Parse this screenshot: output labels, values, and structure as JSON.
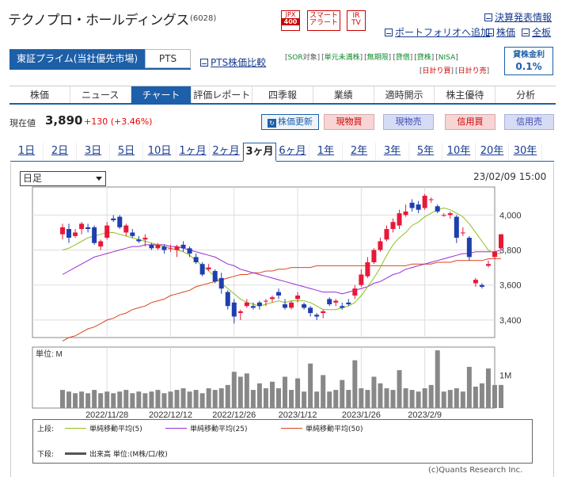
{
  "header": {
    "company": "テクノプロ・ホールディングス",
    "code": "(6028)",
    "badge_jpx_top": "JPX",
    "badge_jpx_bottom": "400",
    "badge_smart_1": "スマート",
    "badge_smart_2": "アラート",
    "badge_ir_1": "IR",
    "badge_ir_2": "TV",
    "link_results": "決算発表情報",
    "link_portfolio": "ポートフォリオへ追加",
    "link_price": "株価",
    "link_board": "全板"
  },
  "market_tabs": {
    "active": "東証プライム(当社優先市場)",
    "pts": "PTS",
    "pts_compare": "PTS株価比較"
  },
  "tags": [
    "[",
    "SOR",
    "対象",
    "]",
    "[",
    "単元未満株",
    "]",
    "[",
    "無期限",
    "]",
    "[",
    "貸借",
    "]",
    "[",
    "貸株",
    "]",
    "[",
    "NISA",
    "]",
    "[",
    "日計り買",
    "]",
    "[",
    "日計り売",
    "]"
  ],
  "lending_rate": {
    "label": "貸株金利",
    "value": "0.1%"
  },
  "nav": [
    "株価",
    "ニュース",
    "チャート",
    "評価レポート",
    "四季報",
    "業績",
    "適時開示",
    "株主優待",
    "分析"
  ],
  "nav_active_index": 2,
  "quote": {
    "label": "現在値",
    "price": "3,890",
    "change": "+130 (+3.46%)"
  },
  "buttons": {
    "update": "株価更新",
    "spot_buy": "現物買",
    "spot_sell": "現物売",
    "margin_buy": "信用買",
    "margin_sell": "信用売"
  },
  "periods": [
    "1日",
    "2日",
    "3日",
    "5日",
    "10日",
    "1ヶ月",
    "2ヶ月",
    "3ヶ月",
    "6ヶ月",
    "1年",
    "2年",
    "3年",
    "5年",
    "10年",
    "20年",
    "30年"
  ],
  "period_active_index": 7,
  "chart_controls": {
    "interval": "日足",
    "datetime": "23/02/09 15:00"
  },
  "legend": {
    "upper_label": "上段:",
    "lower_label": "下段:",
    "ma5": "単純移動平均(5)",
    "ma25": "単純移動平均(25)",
    "ma50": "単純移動平均(50)",
    "volume": "出来高 単位:(M株/口/枚)",
    "colors": {
      "ma5": "#8fbf1e",
      "ma25": "#9a2bd1",
      "ma50": "#d9461f",
      "volume": "#555555",
      "up": "#e8183a",
      "down": "#1f3fae"
    }
  },
  "copyright": "(c)Quants Research Inc.",
  "chart_data": {
    "type": "candlestick",
    "price_ticks": [
      "4,000",
      "3,800",
      "3,600",
      "3,400"
    ],
    "price_tick_values": [
      4000,
      3800,
      3600,
      3400
    ],
    "ylim": [
      3300,
      4160
    ],
    "volume_unit_label": "単位: M",
    "volume_tick": "1M",
    "volume_ylim": [
      0,
      1.85
    ],
    "date_ticks": [
      "2022/11/28",
      "2022/12/12",
      "2022/12/26",
      "2023/1/12",
      "2023/1/26",
      "2023/2/9"
    ],
    "date_tick_index": [
      7,
      17,
      27,
      37,
      47,
      57
    ],
    "candles": [
      [
        3890,
        3950,
        3860,
        3930
      ],
      [
        3920,
        3950,
        3840,
        3870
      ],
      [
        3880,
        3920,
        3870,
        3900
      ],
      [
        3920,
        3960,
        3890,
        3950
      ],
      [
        3930,
        3950,
        3900,
        3920
      ],
      [
        3930,
        3940,
        3830,
        3840
      ],
      [
        3820,
        3860,
        3800,
        3850
      ],
      [
        3870,
        3960,
        3860,
        3940
      ],
      [
        3980,
        4000,
        3960,
        3970
      ],
      [
        3990,
        4000,
        3920,
        3930
      ],
      [
        3900,
        3950,
        3880,
        3940
      ],
      [
        3900,
        3920,
        3870,
        3880
      ],
      [
        3860,
        3880,
        3840,
        3850
      ],
      [
        3860,
        3890,
        3820,
        3870
      ],
      [
        3830,
        3840,
        3800,
        3810
      ],
      [
        3810,
        3840,
        3800,
        3830
      ],
      [
        3820,
        3830,
        3780,
        3800
      ],
      [
        3810,
        3830,
        3790,
        3810
      ],
      [
        3800,
        3830,
        3760,
        3820
      ],
      [
        3830,
        3850,
        3790,
        3810
      ],
      [
        3810,
        3820,
        3760,
        3780
      ],
      [
        3760,
        3780,
        3720,
        3730
      ],
      [
        3720,
        3730,
        3650,
        3660
      ],
      [
        3690,
        3720,
        3680,
        3700
      ],
      [
        3680,
        3690,
        3610,
        3620
      ],
      [
        3640,
        3670,
        3550,
        3580
      ],
      [
        3560,
        3570,
        3460,
        3480
      ],
      [
        3500,
        3520,
        3380,
        3420
      ],
      [
        3440,
        3460,
        3400,
        3450
      ],
      [
        3480,
        3520,
        3470,
        3500
      ],
      [
        3480,
        3500,
        3460,
        3470
      ],
      [
        3500,
        3510,
        3460,
        3480
      ],
      [
        3510,
        3520,
        3480,
        3510
      ],
      [
        3520,
        3540,
        3500,
        3530
      ],
      [
        3560,
        3580,
        3520,
        3540
      ],
      [
        3490,
        3520,
        3460,
        3470
      ],
      [
        3470,
        3510,
        3460,
        3500
      ],
      [
        3520,
        3560,
        3500,
        3540
      ],
      [
        3490,
        3500,
        3460,
        3470
      ],
      [
        3470,
        3480,
        3420,
        3440
      ],
      [
        3430,
        3440,
        3400,
        3420
      ],
      [
        3440,
        3460,
        3410,
        3450
      ],
      [
        3520,
        3530,
        3480,
        3490
      ],
      [
        3500,
        3520,
        3480,
        3510
      ],
      [
        3480,
        3500,
        3460,
        3470
      ],
      [
        3500,
        3520,
        3480,
        3490
      ],
      [
        3540,
        3600,
        3520,
        3580
      ],
      [
        3600,
        3690,
        3590,
        3660
      ],
      [
        3650,
        3760,
        3640,
        3730
      ],
      [
        3730,
        3810,
        3720,
        3800
      ],
      [
        3800,
        3870,
        3790,
        3850
      ],
      [
        3860,
        3940,
        3850,
        3920
      ],
      [
        3920,
        3980,
        3900,
        3960
      ],
      [
        3940,
        4030,
        3920,
        4010
      ],
      [
        4000,
        4060,
        3990,
        4020
      ],
      [
        4070,
        4090,
        4020,
        4040
      ],
      [
        4060,
        4080,
        4010,
        4030
      ],
      [
        4040,
        4120,
        4030,
        4110
      ],
      [
        4090,
        4100,
        4070,
        4090
      ],
      [
        4050,
        4060,
        4010,
        4020
      ],
      [
        4000,
        4010,
        3990,
        4000
      ],
      [
        4000,
        4020,
        3980,
        4010
      ],
      [
        3990,
        4000,
        3840,
        3870
      ],
      [
        3900,
        3930,
        3880,
        3900
      ],
      [
        3870,
        3880,
        3740,
        3760
      ],
      [
        3610,
        3640,
        3590,
        3630
      ],
      [
        3600,
        3610,
        3580,
        3590
      ],
      [
        3710,
        3740,
        3700,
        3720
      ],
      [
        3760,
        3800,
        3750,
        3790
      ],
      [
        3810,
        3890,
        3800,
        3890
      ]
    ],
    "ma5": [
      3800,
      3810,
      3830,
      3850,
      3870,
      3880,
      3890,
      3900,
      3900,
      3890,
      3880,
      3870,
      3860,
      3850,
      3840,
      3830,
      3820,
      3810,
      3800,
      3790,
      3770,
      3740,
      3710,
      3680,
      3650,
      3610,
      3580,
      3550,
      3520,
      3500,
      3490,
      3480,
      3490,
      3500,
      3510,
      3500,
      3510,
      3510,
      3510,
      3500,
      3480,
      3460,
      3460,
      3460,
      3470,
      3480,
      3500,
      3540,
      3590,
      3640,
      3700,
      3770,
      3830,
      3870,
      3900,
      3940,
      3960,
      3990,
      4010,
      4030,
      4040,
      4030,
      4010,
      3990,
      3950,
      3900,
      3850,
      3800,
      3780,
      3780
    ],
    "ma25": [
      3660,
      3680,
      3700,
      3720,
      3740,
      3760,
      3770,
      3780,
      3790,
      3800,
      3810,
      3820,
      3820,
      3830,
      3830,
      3830,
      3830,
      3820,
      3820,
      3810,
      3800,
      3790,
      3780,
      3770,
      3760,
      3740,
      3720,
      3710,
      3690,
      3680,
      3670,
      3660,
      3650,
      3640,
      3630,
      3620,
      3610,
      3600,
      3590,
      3580,
      3570,
      3560,
      3560,
      3560,
      3550,
      3560,
      3570,
      3580,
      3590,
      3610,
      3620,
      3640,
      3660,
      3670,
      3690,
      3700,
      3710,
      3720,
      3730,
      3740,
      3750,
      3760,
      3770,
      3780,
      3780,
      3790,
      3790,
      3790,
      3790,
      3800
    ],
    "ma50": [
      3280,
      3300,
      3310,
      3330,
      3350,
      3360,
      3380,
      3400,
      3410,
      3430,
      3440,
      3460,
      3470,
      3480,
      3500,
      3510,
      3520,
      3540,
      3550,
      3560,
      3570,
      3590,
      3600,
      3610,
      3620,
      3630,
      3640,
      3650,
      3660,
      3660,
      3670,
      3670,
      3680,
      3680,
      3690,
      3690,
      3700,
      3700,
      3700,
      3700,
      3710,
      3710,
      3710,
      3710,
      3710,
      3710,
      3710,
      3710,
      3710,
      3710,
      3710,
      3710,
      3710,
      3710,
      3710,
      3720,
      3720,
      3720,
      3720,
      3730,
      3730,
      3730,
      3740,
      3740,
      3740,
      3740,
      3740,
      3750,
      3750,
      3750
    ],
    "volume": [
      0.55,
      0.5,
      0.45,
      0.5,
      0.45,
      0.55,
      0.45,
      0.5,
      0.45,
      0.5,
      0.55,
      0.45,
      0.5,
      0.45,
      0.5,
      0.55,
      0.45,
      0.5,
      0.55,
      0.6,
      0.5,
      0.55,
      0.45,
      0.6,
      0.55,
      0.6,
      0.7,
      1.1,
      0.95,
      1.05,
      0.55,
      0.75,
      0.6,
      0.8,
      0.6,
      0.95,
      0.55,
      0.9,
      0.5,
      1.35,
      0.5,
      1.0,
      0.5,
      0.55,
      0.85,
      0.55,
      1.45,
      0.6,
      0.55,
      0.95,
      0.75,
      0.6,
      0.55,
      1.15,
      0.6,
      0.55,
      0.5,
      0.6,
      0.7,
      1.75,
      0.5,
      0.55,
      0.6,
      0.5,
      1.25,
      0.65,
      0.75,
      1.2,
      0.7,
      0.7
    ]
  }
}
